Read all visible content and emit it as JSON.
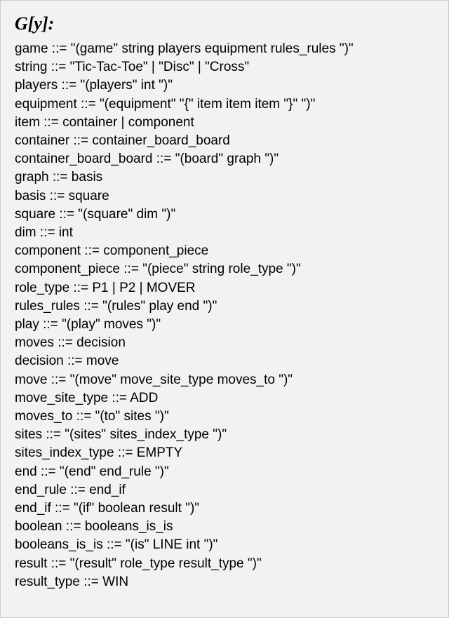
{
  "title": "G[y]:",
  "rules": [
    "game ::= \"(game\" string players equipment rules_rules \")\"",
    "string ::= \"Tic-Tac-Toe\" | \"Disc\" | \"Cross\"",
    "players ::= \"(players\" int \")\"",
    "equipment ::= \"(equipment\" \"{\" item item item \"}\" \")\"",
    "item ::= container | component",
    "container ::= container_board_board",
    "container_board_board ::= \"(board\" graph \")\"",
    "graph ::= basis",
    "basis ::= square",
    "square ::= \"(square\" dim \")\"",
    "dim ::= int",
    "component ::= component_piece",
    "component_piece ::= \"(piece\" string role_type \")\"",
    "role_type ::= P1 | P2 | MOVER",
    "rules_rules ::= \"(rules\" play end \")\"",
    "play ::= \"(play\" moves \")\"",
    "moves ::= decision",
    "decision ::= move",
    "move ::= \"(move\" move_site_type moves_to \")\"",
    "move_site_type ::= ADD",
    "moves_to ::= \"(to\" sites \")\"",
    "sites ::= \"(sites\" sites_index_type \")\"",
    "sites_index_type ::= EMPTY",
    "end ::= \"(end\" end_rule \")\"",
    "end_rule ::= end_if",
    "end_if ::= \"(if\" boolean result \")\"",
    "boolean ::= booleans_is_is",
    "booleans_is_is ::= \"(is\" LINE int \")\"",
    "result ::= \"(result\" role_type result_type \")\"",
    "result_type ::= WIN"
  ]
}
